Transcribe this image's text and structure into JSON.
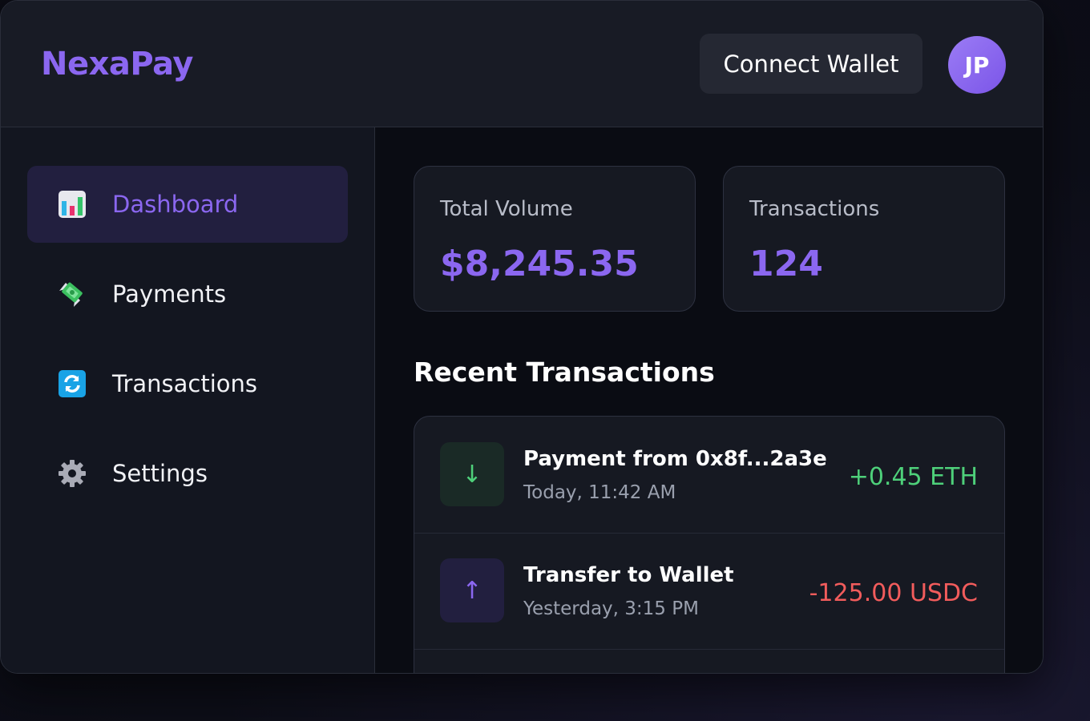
{
  "header": {
    "logo": "NexaPay",
    "connect_wallet": "Connect Wallet",
    "avatar_initials": "JP"
  },
  "sidebar": {
    "items": [
      {
        "label": "Dashboard",
        "icon": "bar-chart-icon",
        "active": true
      },
      {
        "label": "Payments",
        "icon": "money-with-wings-icon",
        "active": false
      },
      {
        "label": "Transactions",
        "icon": "refresh-arrows-icon",
        "active": false
      },
      {
        "label": "Settings",
        "icon": "gear-icon",
        "active": false
      }
    ]
  },
  "stats": [
    {
      "label": "Total Volume",
      "value": "$8,245.35"
    },
    {
      "label": "Transactions",
      "value": "124"
    }
  ],
  "recent": {
    "title": "Recent Transactions",
    "items": [
      {
        "title": "Payment from 0x8f...2a3e",
        "time": "Today, 11:42 AM",
        "amount": "+0.45 ETH",
        "direction": "in",
        "arrow": "↓"
      },
      {
        "title": "Transfer to Wallet",
        "time": "Yesterday, 3:15 PM",
        "amount": "-125.00 USDC",
        "direction": "out",
        "arrow": "↑"
      }
    ]
  },
  "colors": {
    "accent": "#8b67f0",
    "positive": "#4ed07a",
    "negative": "#f25c5c",
    "background": "#0a0c13"
  }
}
